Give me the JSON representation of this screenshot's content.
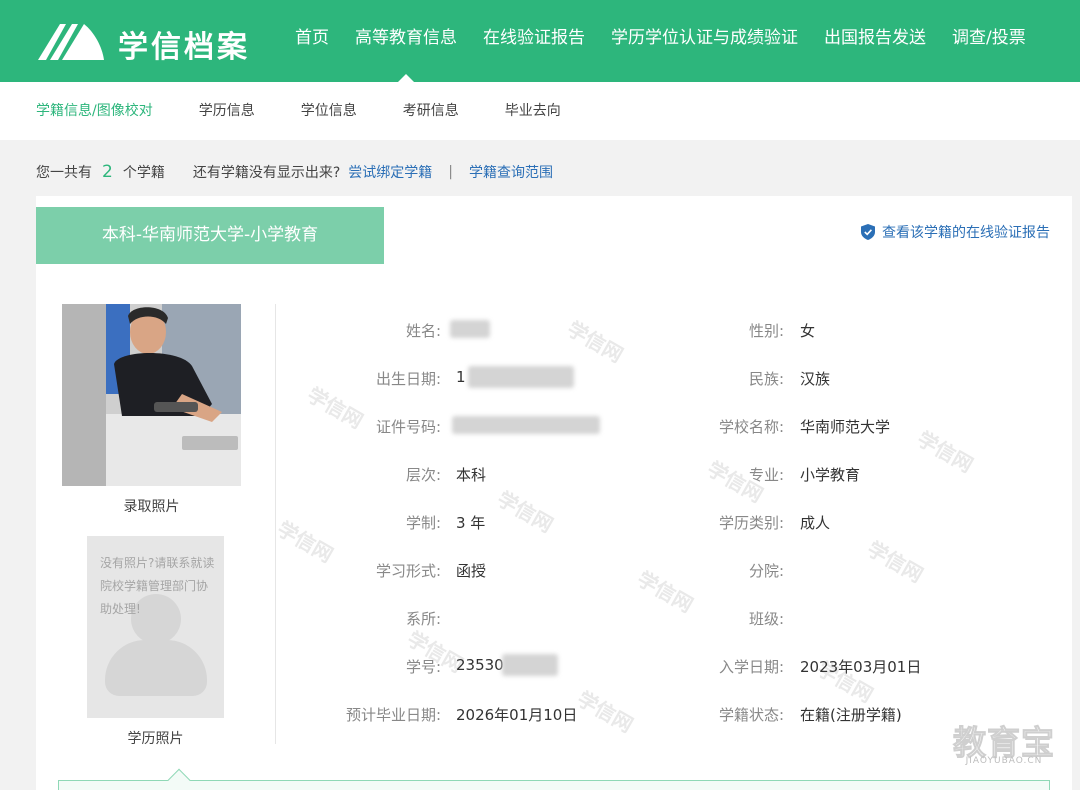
{
  "brand": {
    "name": "学信档案"
  },
  "colors": {
    "brand_green": "#2db67c",
    "tab_green": "#7ccfaa",
    "link_blue": "#2b6fb6"
  },
  "top_nav": [
    {
      "label": "首页"
    },
    {
      "label": "高等教育信息"
    },
    {
      "label": "在线验证报告"
    },
    {
      "label": "学历学位认证与成绩验证"
    },
    {
      "label": "出国报告发送"
    },
    {
      "label": "调查/投票"
    }
  ],
  "sub_nav": [
    {
      "label": "学籍信息/图像校对"
    },
    {
      "label": "学历信息"
    },
    {
      "label": "学位信息"
    },
    {
      "label": "考研信息"
    },
    {
      "label": "毕业去向"
    }
  ],
  "summary": {
    "prefix": "您一共有",
    "count": "2",
    "suffix": "个学籍",
    "question": "还有学籍没有显示出来?",
    "bind_link": "尝试绑定学籍",
    "separator": "|",
    "scope_link": "学籍查询范围"
  },
  "record": {
    "tab_title": "本科-华南师范大学-小学教育",
    "verify_link": "查看该学籍的在线验证报告",
    "photo_admission_label": "录取照片",
    "photo_degree_label": "学历照片",
    "photo_degree_placeholder": "没有照片?请联系就读院校学籍管理部门协助处理!",
    "watermark": "学信网",
    "fields_left": [
      {
        "label": "姓名:",
        "value": ""
      },
      {
        "label": "出生日期:",
        "value": "1"
      },
      {
        "label": "证件号码:",
        "value": ""
      },
      {
        "label": "层次:",
        "value": "本科"
      },
      {
        "label": "学制:",
        "value": "3 年"
      },
      {
        "label": "学习形式:",
        "value": "函授"
      },
      {
        "label": "系所:",
        "value": ""
      },
      {
        "label": "学号:",
        "value": "23530"
      },
      {
        "label": "预计毕业日期:",
        "value": "2026年01月10日"
      }
    ],
    "fields_right": [
      {
        "label": "性别:",
        "value": "女"
      },
      {
        "label": "民族:",
        "value": "汉族"
      },
      {
        "label": "学校名称:",
        "value": "华南师范大学"
      },
      {
        "label": "专业:",
        "value": "小学教育"
      },
      {
        "label": "学历类别:",
        "value": "成人"
      },
      {
        "label": "分院:",
        "value": ""
      },
      {
        "label": "班级:",
        "value": ""
      },
      {
        "label": "入学日期:",
        "value": "2023年03月01日"
      },
      {
        "label": "学籍状态:",
        "value": "在籍(注册学籍)"
      }
    ]
  },
  "corner_watermark": {
    "title": "教育宝",
    "subtitle": "JIAOYUBAO.CN"
  }
}
